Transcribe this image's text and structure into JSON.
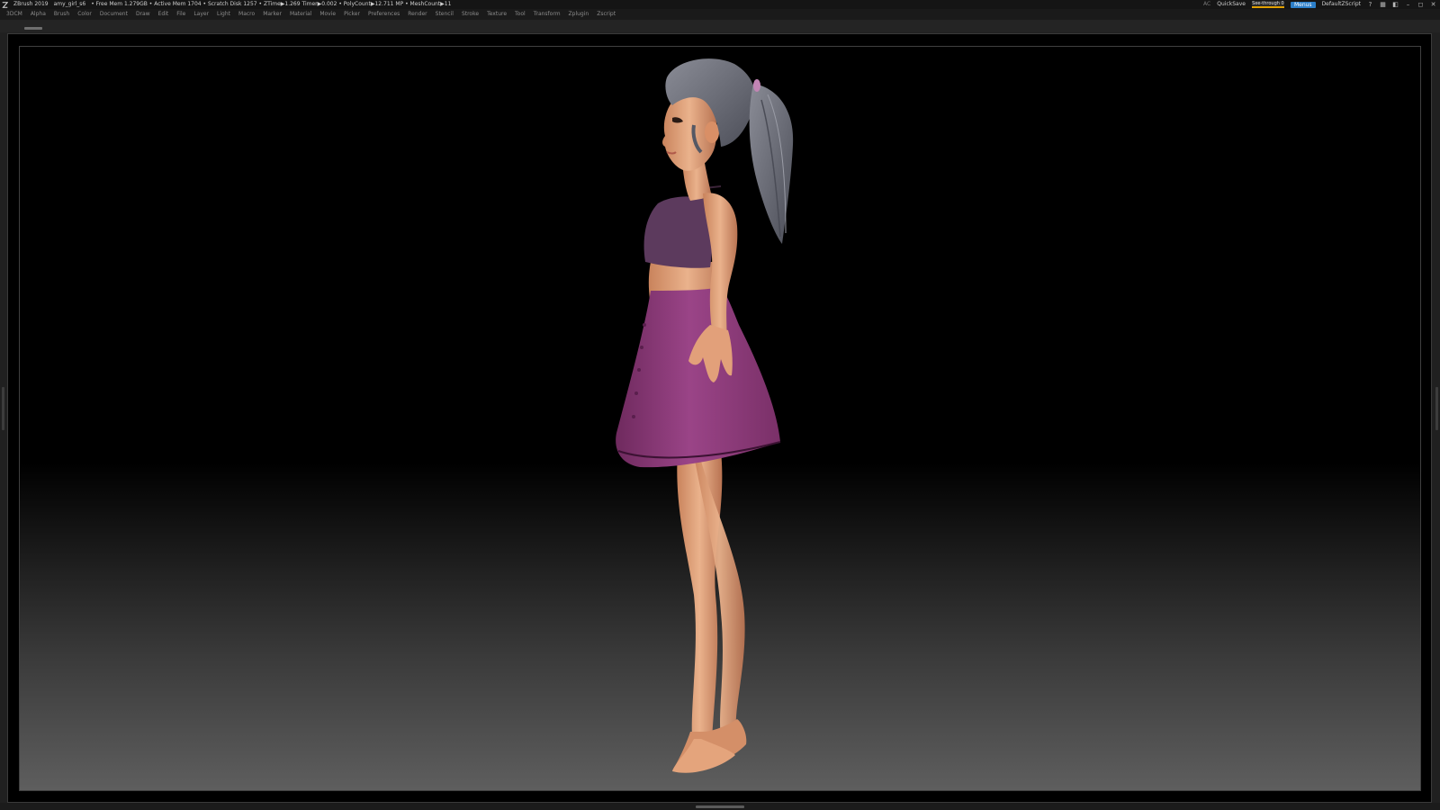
{
  "titlebar": {
    "app_name": "ZBrush 2019",
    "file_name": "amy_girl_s6",
    "stats": "• Free Mem 1.279GB • Active Mem 1704 • Scratch Disk 1257 • ZTime▶1.269 Timer▶0.002 • PolyCount▶12.711 MP • MeshCount▶11",
    "ac_label": "AC",
    "quicksave_label": "QuickSave",
    "seethrough_label": "See-through 0",
    "menus_label": "Menus",
    "script_label": "DefaultZScript"
  },
  "menubar": {
    "items": [
      "3DCM",
      "Alpha",
      "Brush",
      "Color",
      "Document",
      "Draw",
      "Edit",
      "File",
      "Layer",
      "Light",
      "Macro",
      "Marker",
      "Material",
      "Movie",
      "Picker",
      "Preferences",
      "Render",
      "Stencil",
      "Stroke",
      "Texture",
      "Tool",
      "Transform",
      "Zplugin",
      "Zscript"
    ]
  },
  "icons": {
    "logo": "zbrush-logo-icon",
    "help": "help-icon",
    "layout": "layout-icon",
    "lock": "lock-icon",
    "minimize": "minimize-icon",
    "maximize": "maximize-icon",
    "close": "close-icon"
  },
  "colors": {
    "accent_blue": "#2c7fc9",
    "seethrough_bar": "#e0a000",
    "skirt": "#8e3b7a",
    "top": "#5e3b5f",
    "hair": "#6b6d78",
    "skin": "#e6a47a"
  }
}
